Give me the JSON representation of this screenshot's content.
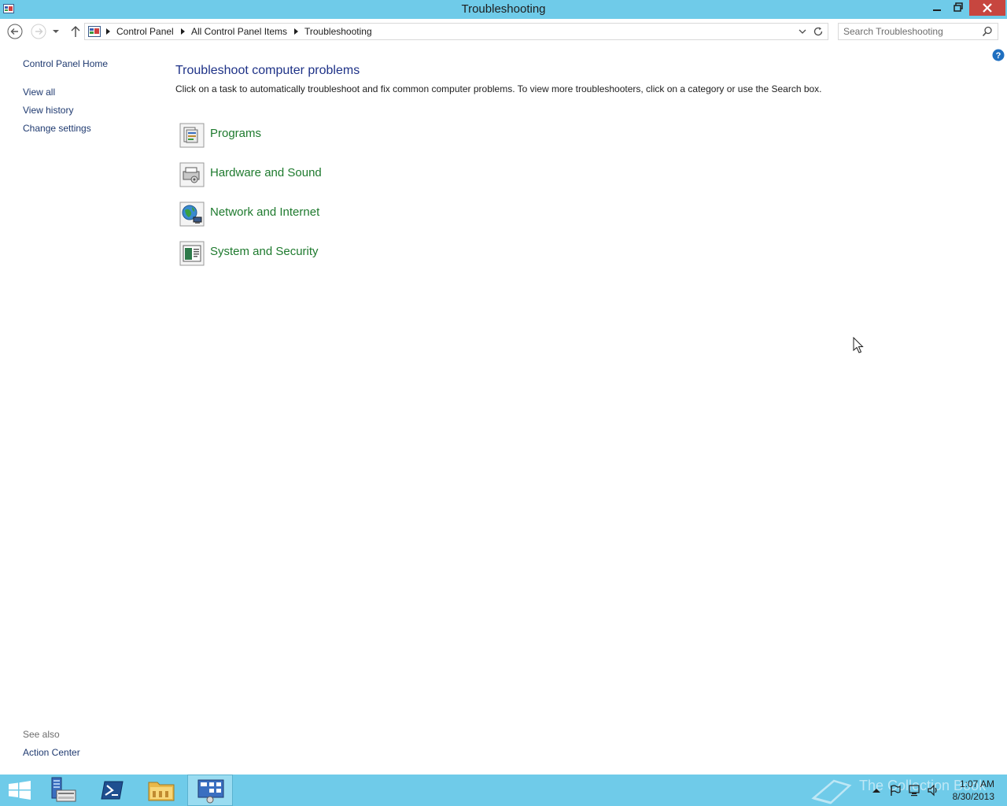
{
  "window": {
    "title": "Troubleshooting"
  },
  "address": {
    "crumbs": [
      "Control Panel",
      "All Control Panel Items",
      "Troubleshooting"
    ]
  },
  "search": {
    "placeholder": "Search Troubleshooting"
  },
  "sidebar": {
    "home": "Control Panel Home",
    "links": [
      "View all",
      "View history",
      "Change settings"
    ],
    "see_also_label": "See also",
    "see_also_links": [
      "Action Center"
    ]
  },
  "main": {
    "title": "Troubleshoot computer problems",
    "description": "Click on a task to automatically troubleshoot and fix common computer problems. To view more troubleshooters, click on a category or use the Search box.",
    "categories": [
      {
        "label": "Programs",
        "icon": "programs-icon"
      },
      {
        "label": "Hardware and Sound",
        "icon": "hardware-sound-icon"
      },
      {
        "label": "Network and Internet",
        "icon": "network-internet-icon"
      },
      {
        "label": "System and Security",
        "icon": "system-security-icon"
      }
    ]
  },
  "taskbar": {
    "watermark": "The Collection Book",
    "clock": {
      "time": "1:07 AM",
      "date": "8/30/2013"
    }
  },
  "colors": {
    "chrome": "#6fcbe9",
    "close_button": "#c7463f",
    "title_link": "#1e3287",
    "category_link": "#1e7a2e"
  }
}
